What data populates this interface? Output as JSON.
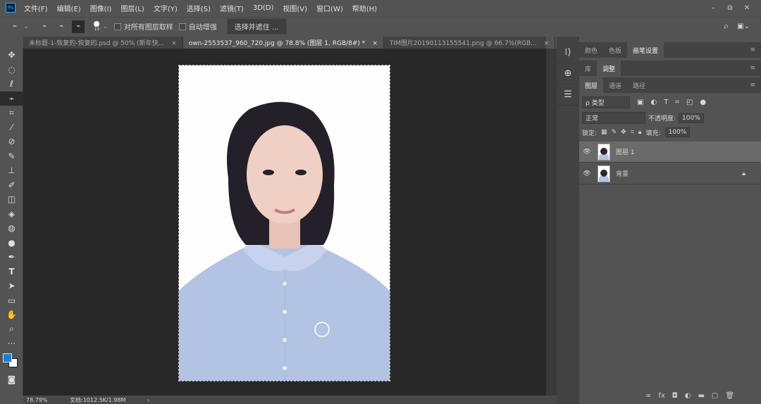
{
  "menubar": {
    "logo": "Ps",
    "items": [
      "文件(F)",
      "编辑(E)",
      "图像(I)",
      "图层(L)",
      "文字(Y)",
      "选择(S)",
      "滤镜(T)",
      "3D(D)",
      "视图(V)",
      "窗口(W)",
      "帮助(H)"
    ],
    "window_controls": [
      "–",
      "⧉",
      "✕"
    ]
  },
  "options": {
    "brush_size": "14",
    "sample_all_layers": "对所有图层取样",
    "auto_enhance": "自动增强",
    "select_mask": "选择并遮住 ..."
  },
  "tabs": [
    {
      "label": "未标题-1-恢复的-恢复的.psd @ 50% (新年快...",
      "close": "×"
    },
    {
      "label": "own-2553537_960_720.jpg @ 78.8% (图层 1, RGB/8#) *",
      "close": "×"
    },
    {
      "label": "TIM图片20190113155541.png @ 66.7%(RGB...",
      "close": "×"
    }
  ],
  "status": {
    "zoom": "78.79%",
    "doc": "文档:1012.5K/1.98M",
    "arrow": "›"
  },
  "panel": {
    "row1": [
      "颜色",
      "色板",
      "画笔设置"
    ],
    "row2": [
      "库",
      "调整"
    ],
    "row3": [
      "图层",
      "通道",
      "路径"
    ],
    "filter": "ρ 类型",
    "blend_mode": "正常",
    "opacity_label": "不透明度:",
    "opacity": "100%",
    "lock_label": "锁定:",
    "fill_label": "填充:",
    "fill": "100%",
    "layers": [
      {
        "name": "图层 1",
        "selected": true
      },
      {
        "name": "背景",
        "locked": true
      }
    ],
    "bottom_icons": [
      "∞",
      "fx",
      "◘",
      "◐",
      "▬",
      "▢",
      "🗑"
    ]
  },
  "colors": {
    "foreground": "#1e7fd6",
    "background": "#ffffff"
  }
}
